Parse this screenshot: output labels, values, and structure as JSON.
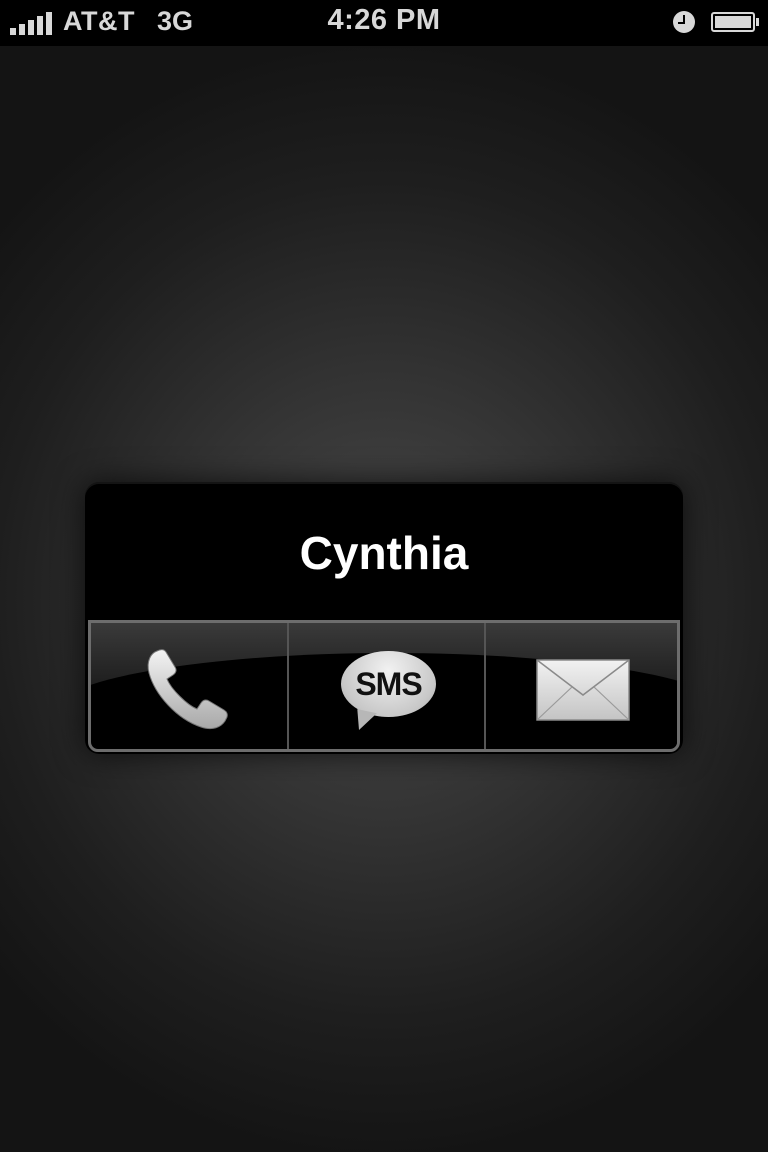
{
  "status_bar": {
    "carrier": "AT&T",
    "network": "3G",
    "time": "4:26 PM",
    "signal_bars": 5,
    "icons": [
      "signal-icon",
      "clock-icon",
      "battery-icon"
    ]
  },
  "contact": {
    "name": "Cynthia"
  },
  "actions": {
    "call_icon": "phone-icon",
    "sms_label": "SMS",
    "mail_icon": "envelope-icon"
  }
}
